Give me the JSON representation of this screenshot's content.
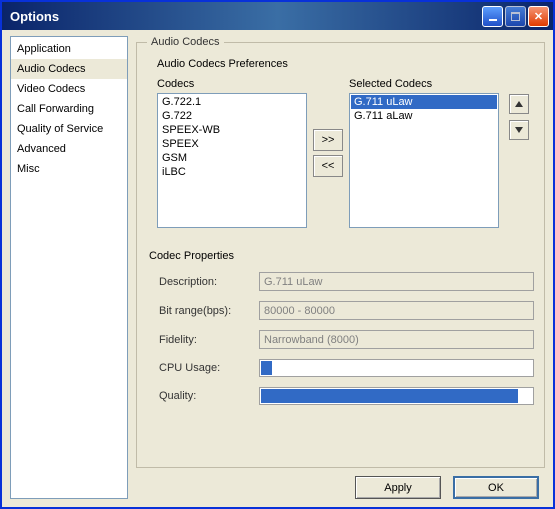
{
  "window": {
    "title": "Options"
  },
  "sidebar": {
    "items": [
      {
        "label": "Application",
        "selected": false
      },
      {
        "label": "Audio Codecs",
        "selected": true
      },
      {
        "label": "Video Codecs",
        "selected": false
      },
      {
        "label": "Call Forwarding",
        "selected": false
      },
      {
        "label": "Quality of Service",
        "selected": false
      },
      {
        "label": "Advanced",
        "selected": false
      },
      {
        "label": "Misc",
        "selected": false
      }
    ]
  },
  "panel": {
    "group_title": "Audio Codecs",
    "preferences_label": "Audio Codecs Preferences",
    "codecs_label": "Codecs",
    "selected_codecs_label": "Selected Codecs",
    "available": [
      "G.722.1",
      "G.722",
      "SPEEX-WB",
      "SPEEX",
      "GSM",
      "iLBC"
    ],
    "selected": [
      {
        "label": "G.711 uLaw",
        "selected": true
      },
      {
        "label": "G.711 aLaw",
        "selected": false
      }
    ],
    "move_right": ">>",
    "move_left": "<<",
    "codec_properties_label": "Codec Properties",
    "props": {
      "description_label": "Description:",
      "description_value": "G.711 uLaw",
      "bitrange_label": "Bit range(bps):",
      "bitrange_value": "80000 - 80000",
      "fidelity_label": "Fidelity:",
      "fidelity_value": "Narrowband (8000)",
      "cpu_label": "CPU Usage:",
      "cpu_percent": 4,
      "quality_label": "Quality:",
      "quality_percent": 95
    }
  },
  "footer": {
    "apply": "Apply",
    "ok": "OK"
  }
}
